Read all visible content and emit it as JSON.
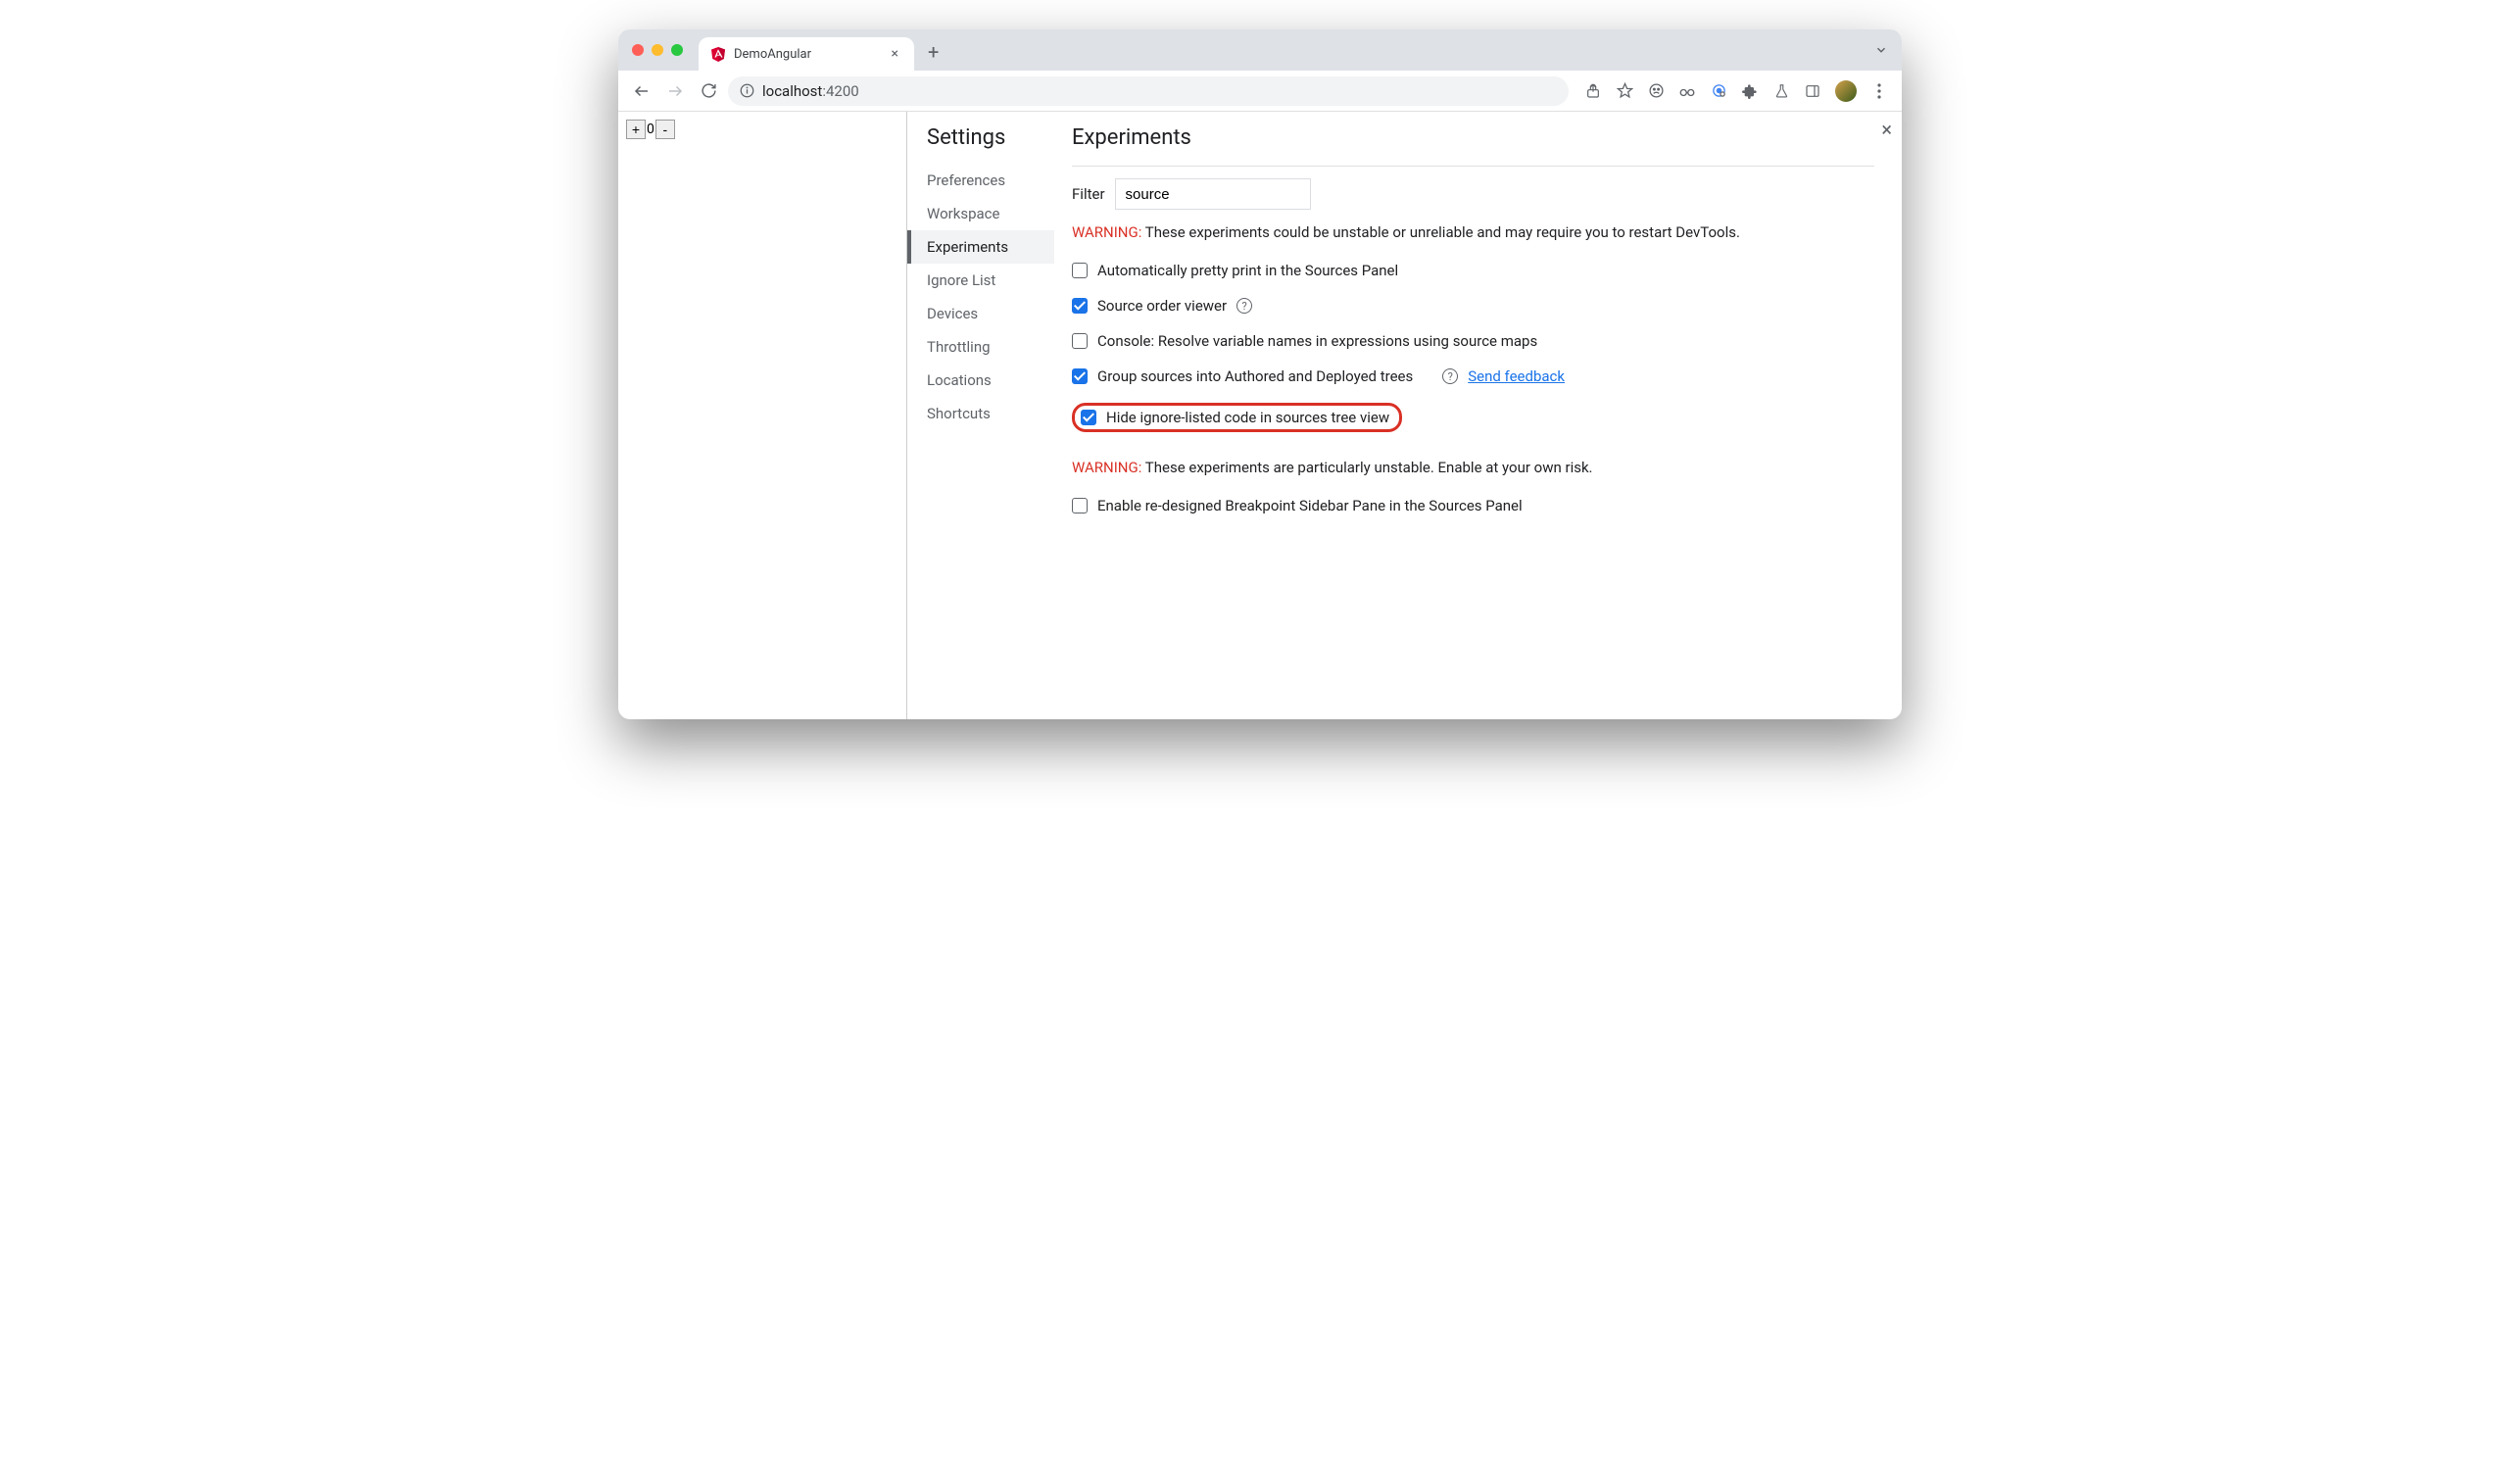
{
  "browser": {
    "tab_title": "DemoAngular",
    "url_host": "localhost",
    "url_port": ":4200",
    "new_tab": "+",
    "close_tab": "×"
  },
  "page": {
    "counter_value": "0",
    "plus": "+",
    "minus": "-"
  },
  "settings": {
    "title": "Settings",
    "nav": {
      "preferences": "Preferences",
      "workspace": "Workspace",
      "experiments": "Experiments",
      "ignore_list": "Ignore List",
      "devices": "Devices",
      "throttling": "Throttling",
      "locations": "Locations",
      "shortcuts": "Shortcuts"
    }
  },
  "experiments": {
    "heading": "Experiments",
    "filter_label": "Filter",
    "filter_value": "source",
    "warning1_label": "WARNING:",
    "warning1_text": " These experiments could be unstable or unreliable and may require you to restart DevTools.",
    "items": {
      "pretty_print": "Automatically pretty print in the Sources Panel",
      "source_order": "Source order viewer",
      "console_resolve": "Console: Resolve variable names in expressions using source maps",
      "group_sources": "Group sources into Authored and Deployed trees",
      "feedback_link": "Send feedback",
      "hide_ignore": "Hide ignore-listed code in sources tree view"
    },
    "warning2_label": "WARNING:",
    "warning2_text": " These experiments are particularly unstable. Enable at your own risk.",
    "items2": {
      "breakpoint_sidebar": "Enable re-designed Breakpoint Sidebar Pane in the Sources Panel"
    }
  },
  "close_glyph": "×"
}
